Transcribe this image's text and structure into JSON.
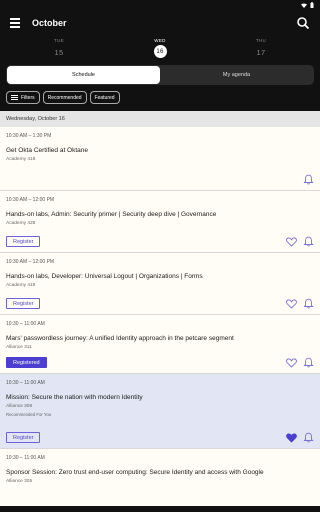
{
  "header": {
    "title": "October"
  },
  "dates": [
    {
      "dow": "TUE",
      "num": "15",
      "active": false
    },
    {
      "dow": "WED",
      "num": "16",
      "active": true
    },
    {
      "dow": "THU",
      "num": "17",
      "active": false
    }
  ],
  "tabs": {
    "schedule": "Schedule",
    "agenda": "My agenda"
  },
  "chips": {
    "filters": "Filters",
    "recommended": "Recommended",
    "featured": "Featured"
  },
  "day_header": "Wednesday, October 16",
  "sessions": [
    {
      "time": "10:30 AM – 1:30 PM",
      "title": "Get Okta Certified at Oktane",
      "room": "Academy 418",
      "button": "",
      "favorited": false,
      "recommended": ""
    },
    {
      "time": "10:30 AM – 12:00 PM",
      "title": "Hands-on labs, Admin: Security primer | Security deep dive | Governance",
      "room": "Academy 428",
      "button": "Register",
      "favorited": false,
      "recommended": ""
    },
    {
      "time": "10:30 AM – 12:00 PM",
      "title": "Hands-on labs, Developer: Universal Logout | Organizations | Forms",
      "room": "Academy 418",
      "button": "Register",
      "favorited": false,
      "recommended": ""
    },
    {
      "time": "10:30 – 11:00 AM",
      "title": "Mars' passwordless journey: A unified Identity approach in the petcare segment",
      "room": "Alliance 311",
      "button": "Registered",
      "favorited": false,
      "recommended": ""
    },
    {
      "time": "10:30 – 11:00 AM",
      "title": "Mission: Secure the nation with modern Identity",
      "room": "Alliance 308",
      "button": "Register",
      "favorited": true,
      "recommended": "Recommended For You"
    },
    {
      "time": "10:30 – 11:00 AM",
      "title": "Sponsor Session: Zero trust end-user computing: Secure Identity and access with Google",
      "room": "Alliance 305",
      "button": "",
      "favorited": false,
      "recommended": ""
    }
  ],
  "colors": {
    "accent": "#4a3fd0",
    "highlight": "#e2e5f3"
  }
}
